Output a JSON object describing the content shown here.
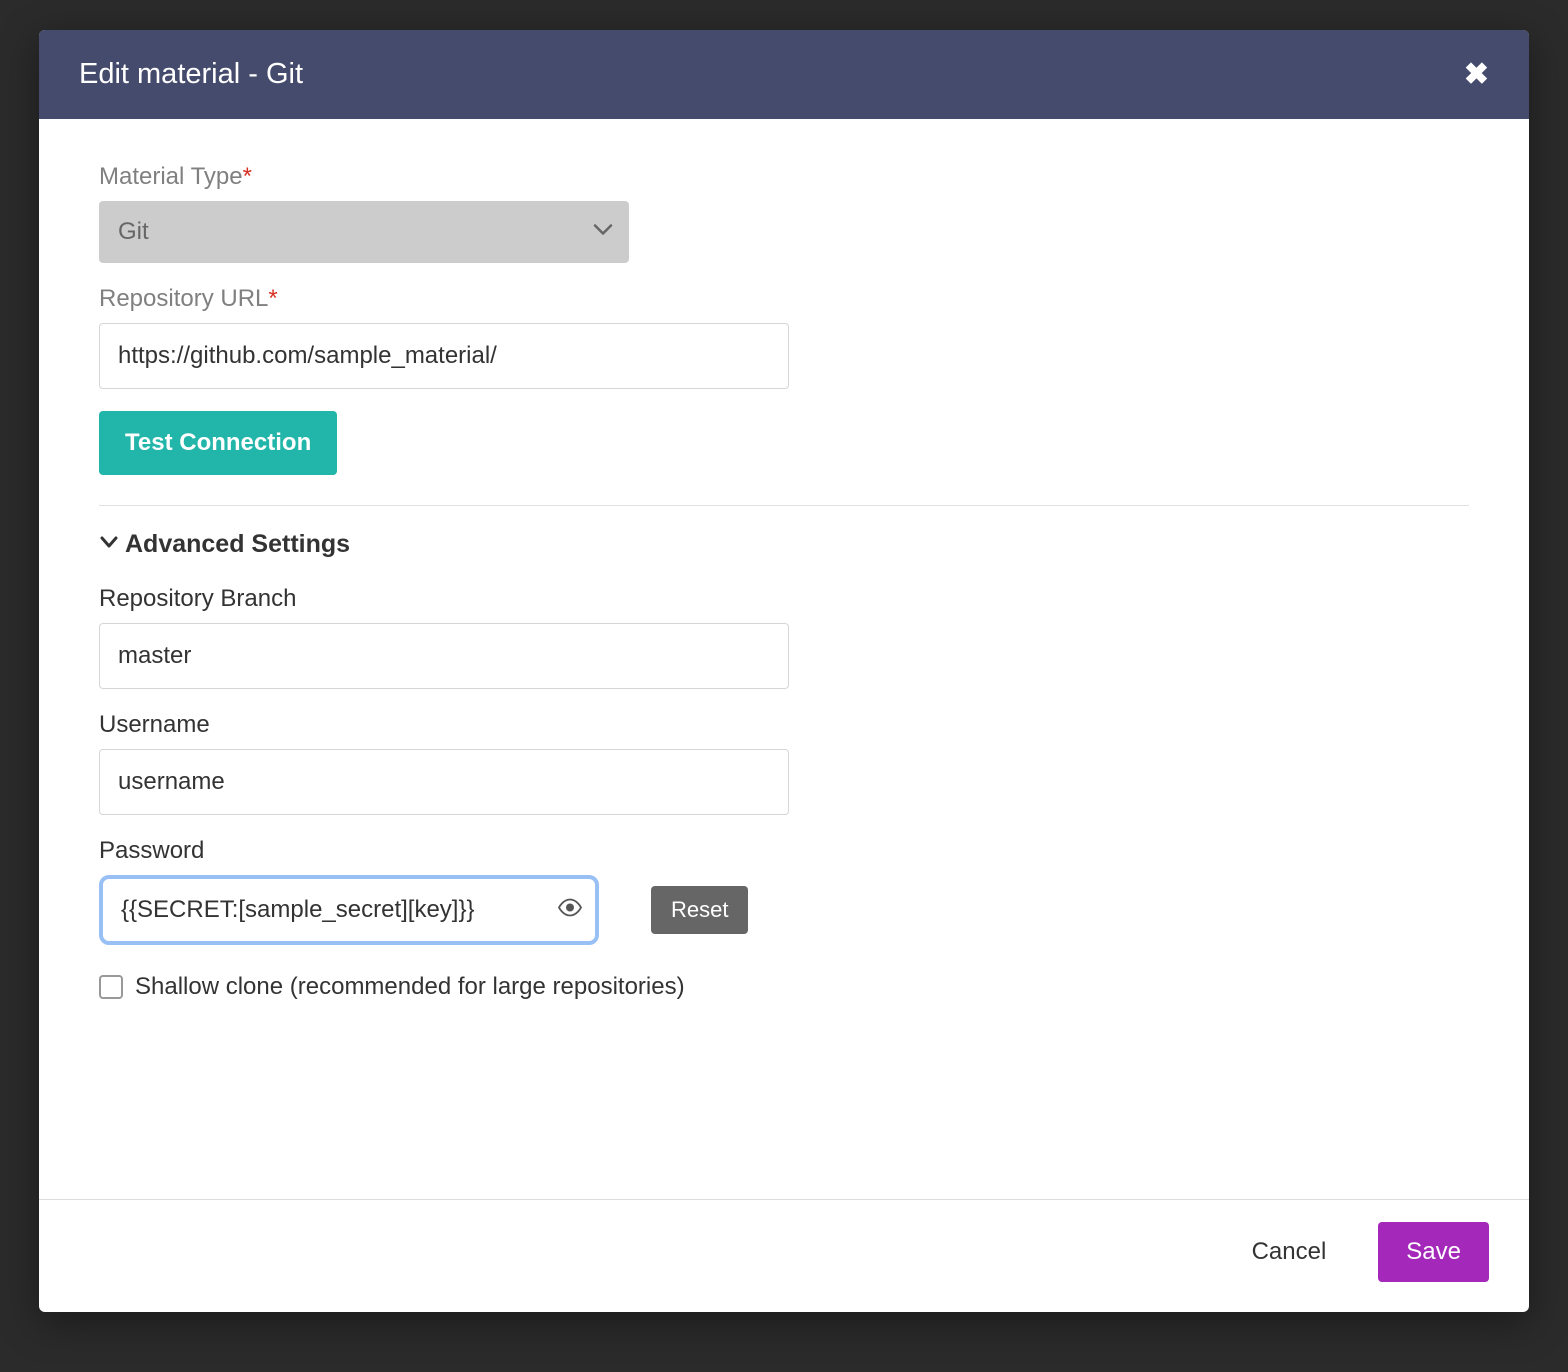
{
  "modal": {
    "title": "Edit material - Git"
  },
  "form": {
    "materialType": {
      "label": "Material Type",
      "value": "Git"
    },
    "repoUrl": {
      "label": "Repository URL",
      "value": "https://github.com/sample_material/"
    },
    "testConnection": {
      "label": "Test Connection"
    },
    "advanced": {
      "title": "Advanced Settings"
    },
    "branch": {
      "label": "Repository Branch",
      "value": "master"
    },
    "username": {
      "label": "Username",
      "value": "username"
    },
    "password": {
      "label": "Password",
      "value": "{{SECRET:[sample_secret][key]}}",
      "reset": "Reset"
    },
    "shallowClone": {
      "label": "Shallow clone (recommended for large repositories)"
    }
  },
  "footer": {
    "cancel": "Cancel",
    "save": "Save"
  }
}
